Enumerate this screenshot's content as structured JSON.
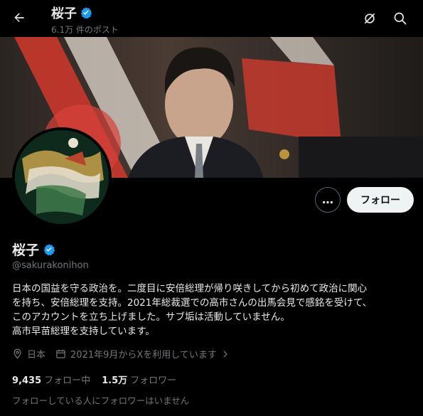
{
  "header": {
    "title": "桜子",
    "post_count": "6.1万 件のポスト",
    "icons": [
      "back-arrow-icon",
      "refresh-icon",
      "search-icon"
    ]
  },
  "profile": {
    "name": "桜子",
    "handle": "@sakurakonihon",
    "verified": true,
    "bio_lines": [
      "日本の国益を守る政治を。二度目に安倍総理が帰り咲きしてから初めて政治に関心",
      "を持ち、安倍総理を支持。2021年総裁選での高市さんの出馬会見で感銘を受けて、",
      "このアカウントを立ち上げました。サブ垢は活動していません。",
      "高市早苗総理を支持しています。"
    ],
    "location": "日本",
    "joined": "2021年9月からXを利用しています"
  },
  "actions": {
    "more_label": "…",
    "follow_label": "フォロー"
  },
  "stats": {
    "following_count": "9,435",
    "following_label": "フォロー中",
    "followers_count": "1.5万",
    "followers_label": "フォロワー"
  },
  "mutuals_note": "フォローしている人にフォロワーはいません",
  "colors": {
    "background": "#000000",
    "text": "#e7e9ea",
    "secondary": "#71767b",
    "verified": "#1d9bf0",
    "follow_bg": "#eff3f4"
  }
}
